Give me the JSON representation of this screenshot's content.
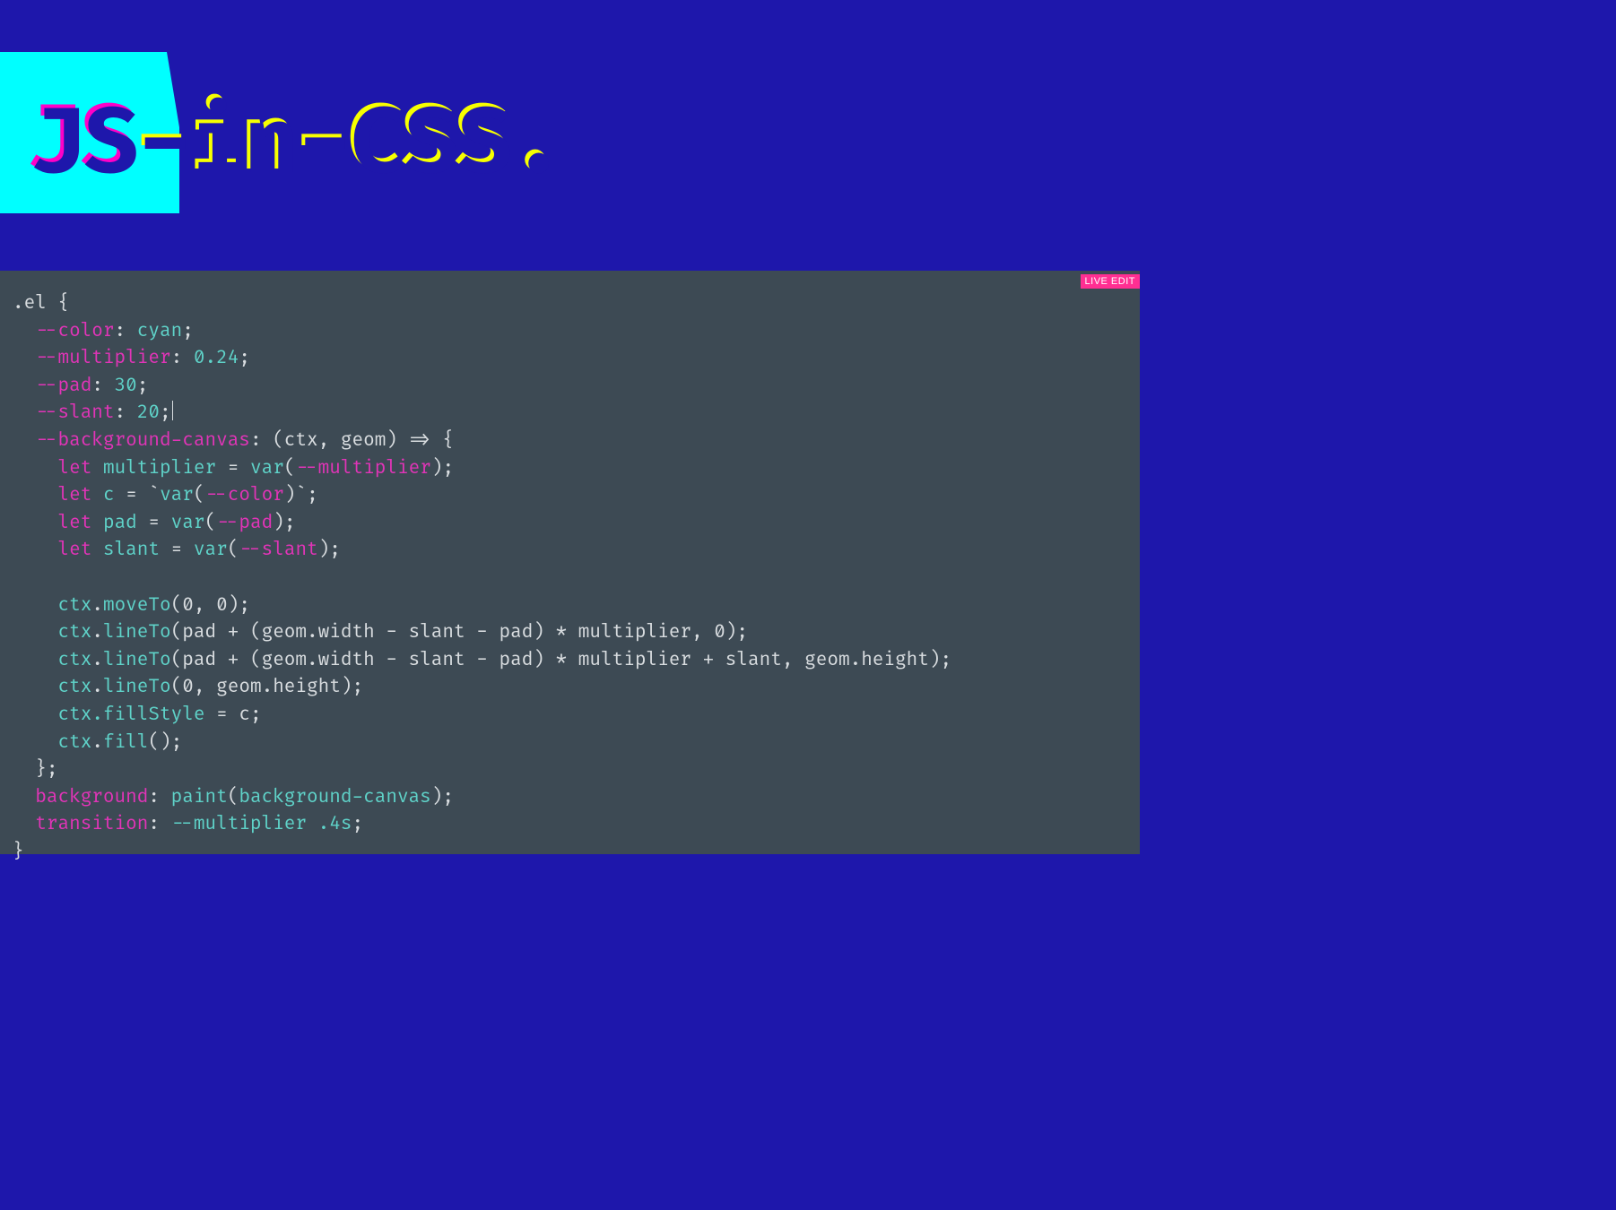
{
  "hero": {
    "title_js": "JS",
    "title_rest": "-in-CSS.",
    "shadow_full": "JS-in-CSS."
  },
  "editor": {
    "badge": "LIVE EDIT"
  },
  "code": {
    "l01_selector": ".el {",
    "l02_prop": "--color",
    "l02_val": "cyan",
    "l03_prop": "--multiplier",
    "l03_val": "0.24",
    "l04_prop": "--pad",
    "l04_val": "30",
    "l05_prop": "--slant",
    "l05_val": "20",
    "l06_prop": "--background-canvas",
    "l06_arrow": "(ctx, geom) => {",
    "l07_let": "let",
    "l07_id": "multiplier",
    "l07_eq": " = ",
    "l07_var": "var",
    "l07_ref": "--multiplier",
    "l08_id": "c",
    "l08_tick1": "`",
    "l08_var": "var",
    "l08_ref": "--color",
    "l08_tick2": "`",
    "l09_id": "pad",
    "l09_var": "var",
    "l09_ref": "--pad",
    "l10_id": "slant",
    "l10_var": "var",
    "l10_ref": "--slant",
    "l12_ctx": "ctx",
    "l12_dot": ".",
    "l12_fn": "moveTo",
    "l12_args": "(0, 0);",
    "l13_fn": "lineTo",
    "l13_args": "(pad + (geom.width - slant - pad) * multiplier, 0);",
    "l14_fn": "lineTo",
    "l14_args": "(pad + (geom.width - slant - pad) * multiplier + slant, geom.height);",
    "l15_fn": "lineTo",
    "l15_args": "(0, geom.height);",
    "l16_lhs": "ctx.fillStyle",
    "l16_rhs": " = c;",
    "l17_lhs": "ctx",
    "l17_fn": "fill",
    "l17_p": "();",
    "l18_close": "};",
    "l19_prop": "background",
    "l19_paint": "paint",
    "l19_arg": "background-canvas",
    "l20_prop": "transition",
    "l20_val1": "--multiplier",
    "l20_val2": ".4s",
    "l21_close": "}"
  }
}
